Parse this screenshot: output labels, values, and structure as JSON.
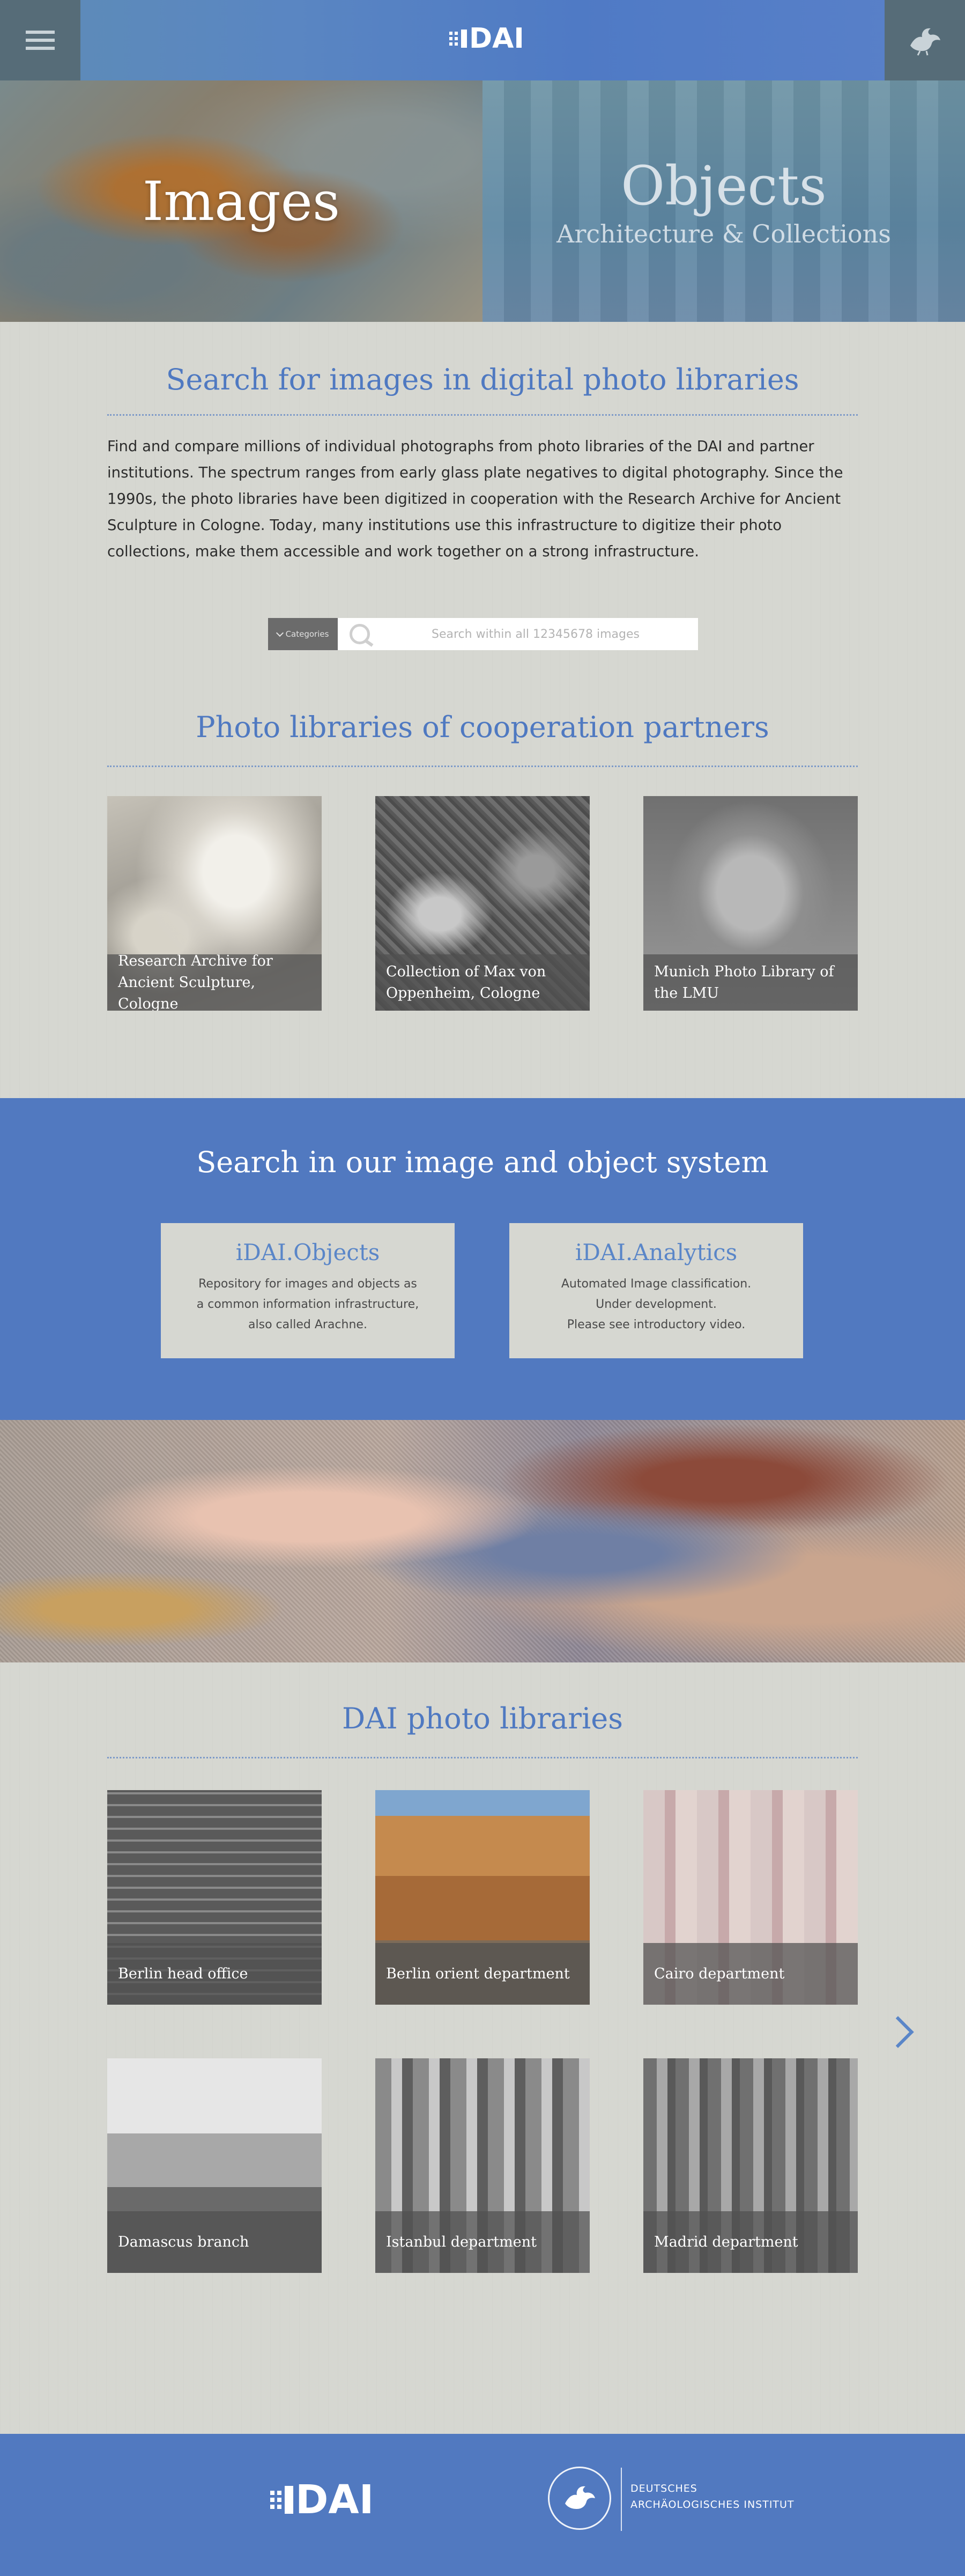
{
  "header": {
    "menu_icon": "hamburger-icon",
    "logo_text": "DAI",
    "griffin_icon": "griffin-icon"
  },
  "hero": {
    "images_title": "Images",
    "objects_title": "Objects",
    "objects_subtitle": "Architecture & Collections"
  },
  "search_section": {
    "title": "Search for images in digital photo libraries",
    "intro": "Find and compare millions of individual photographs from photo libraries of the DAI and partner institutions. The spectrum ranges from early glass plate negatives to digital photography. Since the 1990s, the photo libraries have been digitized in cooperation with the Research Archive for Ancient Sculpture in Cologne. Today, many institutions use this infrastructure to digitize their photo collections, make them accessible and work together on a strong infrastructure.",
    "categories_label": "Categories",
    "search_placeholder": "Search within all 12345678 images"
  },
  "partners": {
    "title": "Photo libraries of cooperation partners",
    "items": [
      {
        "label": "Research Archive for Ancient Sculpture, Cologne"
      },
      {
        "label": "Collection of Max von Oppenheim, Cologne"
      },
      {
        "label": "Munich Photo Library of the LMU"
      }
    ]
  },
  "systems": {
    "title": "Search in our image and object system",
    "items": [
      {
        "title": "iDAI.Objects",
        "desc1": "Repository for images and objects as",
        "desc2": "a common information infrastructure,",
        "desc3": "also called Arachne."
      },
      {
        "title": "iDAI.Analytics",
        "desc1": "Automated Image classification.",
        "desc2": "Under development.",
        "desc3": "Please see introductory video."
      }
    ]
  },
  "dai_libraries": {
    "title": "DAI photo libraries",
    "items": [
      {
        "label": "Berlin head office"
      },
      {
        "label": "Berlin orient department"
      },
      {
        "label": "Cairo department"
      },
      {
        "label": "Damascus branch"
      },
      {
        "label": "Istanbul department"
      },
      {
        "label": "Madrid department"
      }
    ],
    "next_icon": "chevron-right-icon"
  },
  "footer": {
    "logo_text": "DAI",
    "institute_line1": "DEUTSCHES",
    "institute_line2": "ARCHÄOLOGISCHES INSTITUT"
  },
  "colors": {
    "accent": "#5179c0",
    "heading": "#4f79c1",
    "background": "#d6d7d1"
  }
}
